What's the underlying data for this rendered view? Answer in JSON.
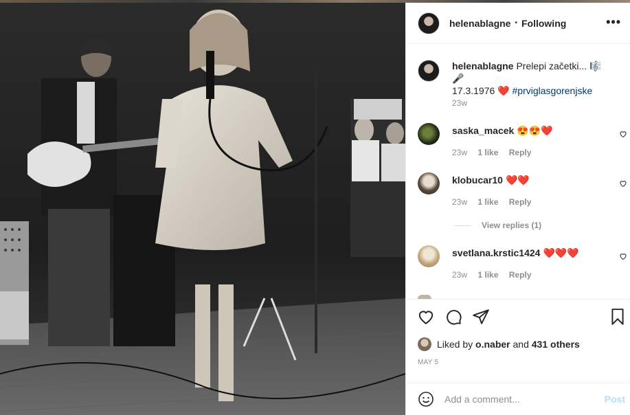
{
  "post": {
    "image_alt": "Vintage black and white concert photo",
    "author": "helenablagne",
    "follow_status": "Following",
    "separator": "•",
    "more_icon": "more-horizontal-icon",
    "caption": {
      "username": "helenablagne",
      "text_part1": "Prelepi začetki... 🎼🎤",
      "text_part2": "17.3.1976 ❤️",
      "hashtag": "#prviglasgorenjske",
      "time": "23w"
    },
    "comments": [
      {
        "username": "saska_macek",
        "text": "😍😍❤️",
        "time": "23w",
        "likes": "1 like",
        "reply_label": "Reply"
      },
      {
        "username": "klobucar10",
        "text": "❤️❤️",
        "time": "23w",
        "likes": "1 like",
        "reply_label": "Reply",
        "view_replies": "View replies (1)"
      },
      {
        "username": "svetlana.krstic1424",
        "text": "❤️❤️❤️",
        "time": "23w",
        "likes": "1 like",
        "reply_label": "Reply"
      }
    ],
    "actions": {
      "like_icon": "heart-icon",
      "comment_icon": "comment-icon",
      "share_icon": "share-icon",
      "save_icon": "bookmark-icon"
    },
    "liked_by": {
      "prefix": "Liked by",
      "user": "o.naber",
      "conjunction": "and",
      "others": "431 others"
    },
    "date": "MAY 5",
    "add_comment": {
      "placeholder": "Add a comment...",
      "post_label": "Post",
      "emoji_icon": "smiley-icon"
    }
  },
  "colors": {
    "link": "#00376b",
    "heart": "#ed4956",
    "post_disabled": "#b2dffc",
    "muted": "#8e8e8e"
  }
}
